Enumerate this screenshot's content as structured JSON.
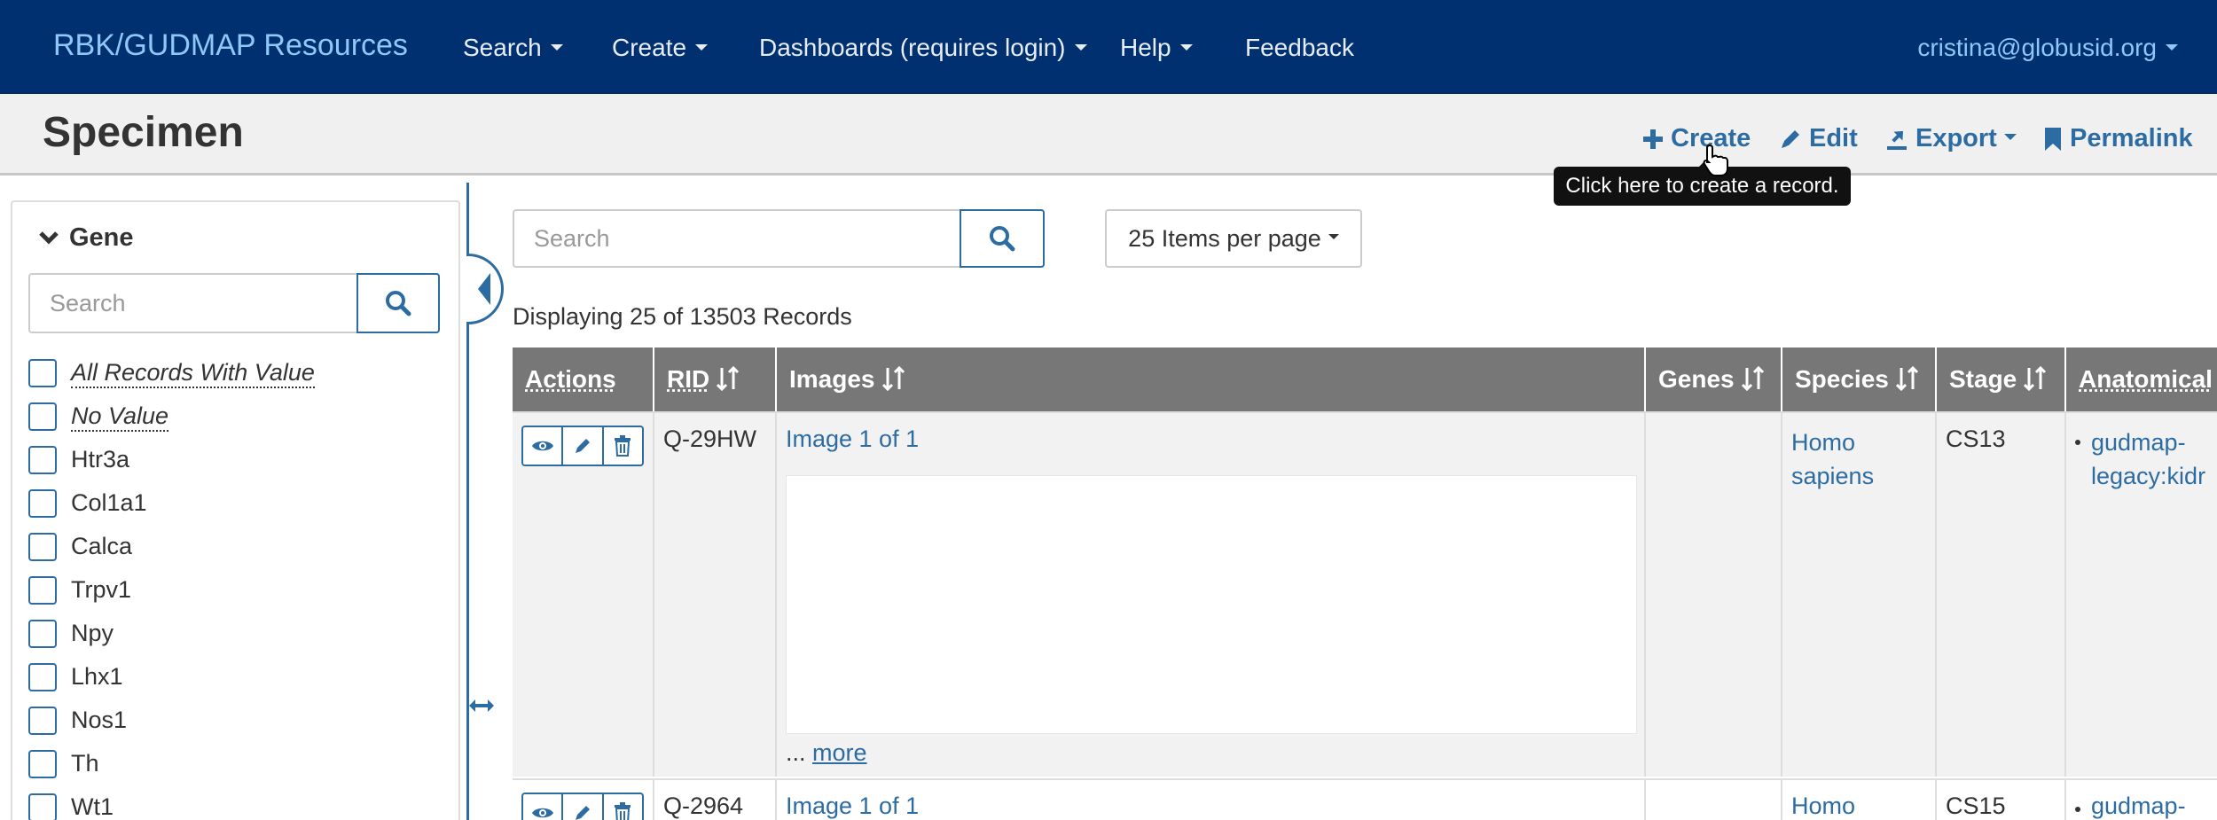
{
  "navbar": {
    "brand": "RBK/GUDMAP Resources",
    "items": [
      {
        "label": "Search"
      },
      {
        "label": "Create"
      },
      {
        "label": "Dashboards (requires login)"
      },
      {
        "label": "Help"
      },
      {
        "label": "Feedback"
      }
    ],
    "user": "cristina@globusid.org"
  },
  "titlebar": {
    "title": "Specimen",
    "actions": {
      "create": "Create",
      "edit": "Edit",
      "export": "Export",
      "permalink": "Permalink"
    },
    "tooltip": "Click here to create a record."
  },
  "sidebar": {
    "facet_title": "Gene",
    "search_placeholder": "Search",
    "items": [
      {
        "label": "All Records With Value",
        "special": true
      },
      {
        "label": "No Value",
        "special": true
      },
      {
        "label": "Htr3a"
      },
      {
        "label": "Col1a1"
      },
      {
        "label": "Calca"
      },
      {
        "label": "Trpv1"
      },
      {
        "label": "Npy"
      },
      {
        "label": "Lhx1"
      },
      {
        "label": "Nos1"
      },
      {
        "label": "Th"
      },
      {
        "label": "Wt1"
      }
    ]
  },
  "main": {
    "search_placeholder": "Search",
    "page_size_label": "25 Items per page",
    "displaying": "Displaying 25 of 13503 Records"
  },
  "table": {
    "columns": [
      "Actions",
      "RID",
      "Images",
      "Genes",
      "Species",
      "Stage",
      "Anatomical"
    ],
    "rows": [
      {
        "rid": "Q-29HW",
        "image": "Image 1 of 1",
        "more_prefix": "...",
        "more": "more",
        "genes": "",
        "species_line1": "Homo",
        "species_line2": "sapiens",
        "stage": "CS13",
        "anatomical_line1": "gudmap-",
        "anatomical_line2": "legacy:kidr"
      },
      {
        "rid": "Q-2964",
        "image": "Image 1 of 1",
        "genes": "",
        "species_line1": "Homo",
        "stage": "CS15",
        "anatomical_line1": "gudmap-"
      }
    ]
  },
  "colors": {
    "navbar_bg": "#00306f",
    "brand": "#8ec8f6",
    "link": "#2d6ca2",
    "table_header_bg": "#777777",
    "tooltip_bg": "#111111"
  },
  "icons": [
    "chevron-down-icon",
    "search-icon",
    "plus-icon",
    "pencil-icon",
    "export-icon",
    "bookmark-icon",
    "eye-icon",
    "trash-icon",
    "sort-icon",
    "collapse-arrow-icon",
    "resize-arrows-icon",
    "pointer-cursor-icon"
  ]
}
